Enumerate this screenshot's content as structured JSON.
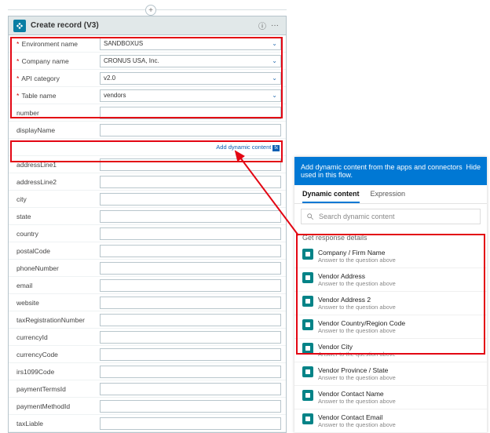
{
  "card": {
    "title": "Create record (V3)",
    "info_icon": "ⓘ",
    "more_icon": "···",
    "required_rows": [
      {
        "label": "Environment name",
        "value": "SANDBOXUS",
        "required": true
      },
      {
        "label": "Company name",
        "value": "CRONUS USA, Inc.",
        "required": true
      },
      {
        "label": "API category",
        "value": "v2.0",
        "required": true
      },
      {
        "label": "Table name",
        "value": "vendors",
        "required": true
      }
    ],
    "plain_rows_top": [
      {
        "label": "number",
        "value": ""
      }
    ],
    "display_row": {
      "label": "displayName",
      "value": ""
    },
    "add_dynamic_label": "Add dynamic content",
    "plain_rows_bottom": [
      {
        "label": "addressLine1",
        "value": ""
      },
      {
        "label": "addressLine2",
        "value": ""
      },
      {
        "label": "city",
        "value": ""
      },
      {
        "label": "state",
        "value": ""
      },
      {
        "label": "country",
        "value": ""
      },
      {
        "label": "postalCode",
        "value": ""
      },
      {
        "label": "phoneNumber",
        "value": ""
      },
      {
        "label": "email",
        "value": ""
      },
      {
        "label": "website",
        "value": ""
      },
      {
        "label": "taxRegistrationNumber",
        "value": ""
      },
      {
        "label": "currencyId",
        "value": ""
      },
      {
        "label": "currencyCode",
        "value": ""
      },
      {
        "label": "irs1099Code",
        "value": ""
      },
      {
        "label": "paymentTermsId",
        "value": ""
      },
      {
        "label": "paymentMethodId",
        "value": ""
      },
      {
        "label": "taxLiable",
        "value": ""
      }
    ]
  },
  "panel": {
    "head_text": "Add dynamic content from the apps and connectors used in this flow.",
    "hide_label": "Hide",
    "tabs": {
      "dynamic": "Dynamic content",
      "expression": "Expression"
    },
    "search_placeholder": "Search dynamic content",
    "section": "Get response details",
    "items": [
      {
        "title": "Company / Firm Name",
        "sub": "Answer to the question above"
      },
      {
        "title": "Vendor Address",
        "sub": "Answer to the question above"
      },
      {
        "title": "Vendor Address 2",
        "sub": "Answer to the question above"
      },
      {
        "title": "Vendor Country/Region Code",
        "sub": "Answer to the question above"
      },
      {
        "title": "Vendor City",
        "sub": "Answer to the question above"
      },
      {
        "title": "Vendor Province / State",
        "sub": "Answer to the question above"
      },
      {
        "title": "Vendor Contact Name",
        "sub": "Answer to the question above"
      },
      {
        "title": "Vendor Contact Email",
        "sub": "Answer to the question above"
      }
    ]
  }
}
